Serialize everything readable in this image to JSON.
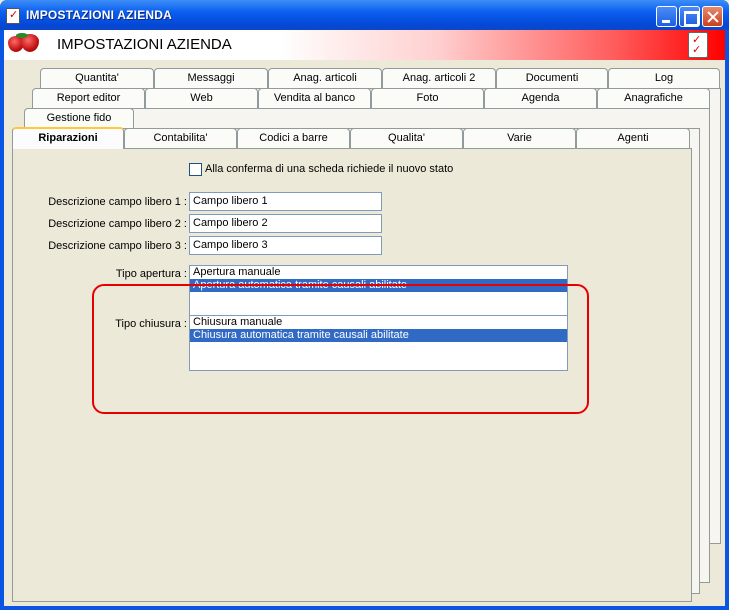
{
  "window": {
    "title": "IMPOSTAZIONI AZIENDA",
    "buttons": [
      "minimize",
      "maximize",
      "close"
    ]
  },
  "banner": {
    "title": "IMPOSTAZIONI AZIENDA",
    "icons": [
      "strawberry-logo-icon",
      "checklist-icon"
    ]
  },
  "tabs": {
    "row1": [
      "Quantita'",
      "Messaggi",
      "Anag. articoli",
      "Anag. articoli 2",
      "Documenti",
      "Log"
    ],
    "row2": [
      "Report editor",
      "Web",
      "Vendita al banco",
      "Foto",
      "Agenda",
      "Anagrafiche"
    ],
    "row3": [
      "Gestione fido"
    ],
    "row4": [
      "Riparazioni",
      "Contabilita'",
      "Codici a barre",
      "Qualita'",
      "Varie",
      "Agenti"
    ],
    "active": "Riparazioni"
  },
  "form": {
    "checkbox_label": "Alla conferma di una scheda richiede il nuovo stato",
    "checkbox_checked": false,
    "fields": [
      {
        "label": "Descrizione campo libero 1 :",
        "value": "Campo libero 1"
      },
      {
        "label": "Descrizione campo libero 2 :",
        "value": "Campo libero 2"
      },
      {
        "label": "Descrizione campo libero 3 :",
        "value": "Campo libero 3"
      }
    ],
    "tipo_apertura": {
      "label": "Tipo apertura :",
      "options": [
        "Apertura manuale",
        "Apertura automatica tramite causali abilitate"
      ],
      "selected": "Apertura automatica tramite causali abilitate"
    },
    "tipo_chiusura": {
      "label": "Tipo chiusura :",
      "options": [
        "Chiusura manuale",
        "Chiusura automatica tramite causali abilitate"
      ],
      "selected": "Chiusura automatica tramite causali abilitate"
    }
  },
  "colors": {
    "title_bar": "#0a5ff0",
    "selection": "#316ac5",
    "highlight_annotation": "#e60000",
    "active_tab_accent": "#ffc83c"
  }
}
